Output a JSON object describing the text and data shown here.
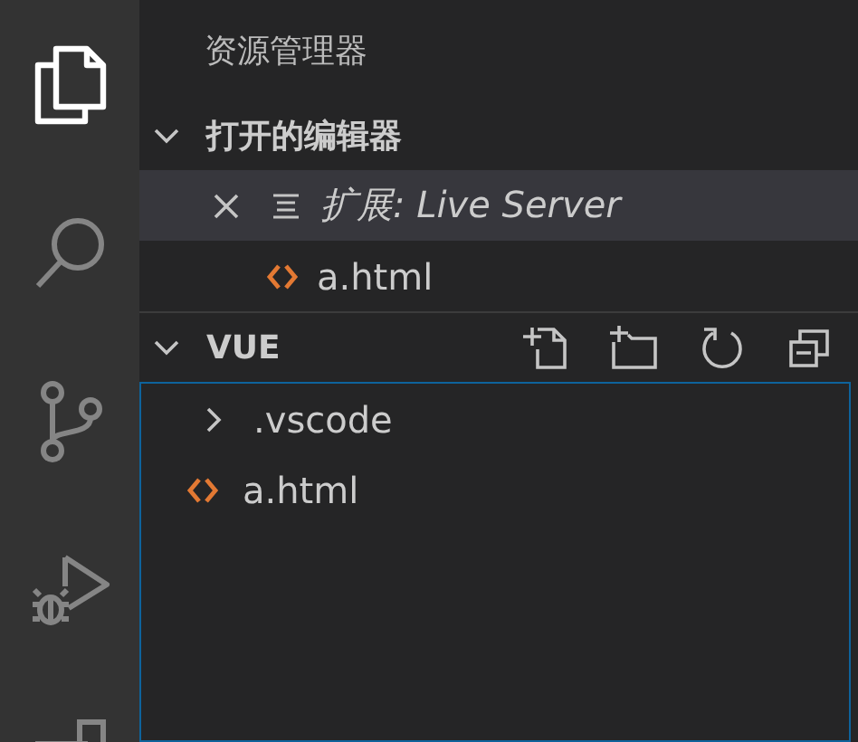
{
  "activity_bar": [
    {
      "kind": "explorer",
      "selected": true
    },
    {
      "kind": "search",
      "selected": false
    },
    {
      "kind": "source-control",
      "selected": false
    },
    {
      "kind": "run-debug",
      "selected": false
    },
    {
      "kind": "extensions",
      "selected": false
    }
  ],
  "sidebar": {
    "title": "资源管理器",
    "open_editors": {
      "title": "打开的编辑器",
      "expanded": true,
      "items": [
        {
          "kind": "preview",
          "name": "扩展: Live Server",
          "italic": true,
          "selected": true
        },
        {
          "kind": "html",
          "name": "a.html",
          "italic": false,
          "selected": false
        }
      ]
    },
    "folder": {
      "title": "VUE",
      "expanded": true,
      "focused": true,
      "items": [
        {
          "kind": "folder",
          "name": ".vscode",
          "expanded": false
        },
        {
          "kind": "html",
          "name": "a.html"
        }
      ]
    }
  }
}
